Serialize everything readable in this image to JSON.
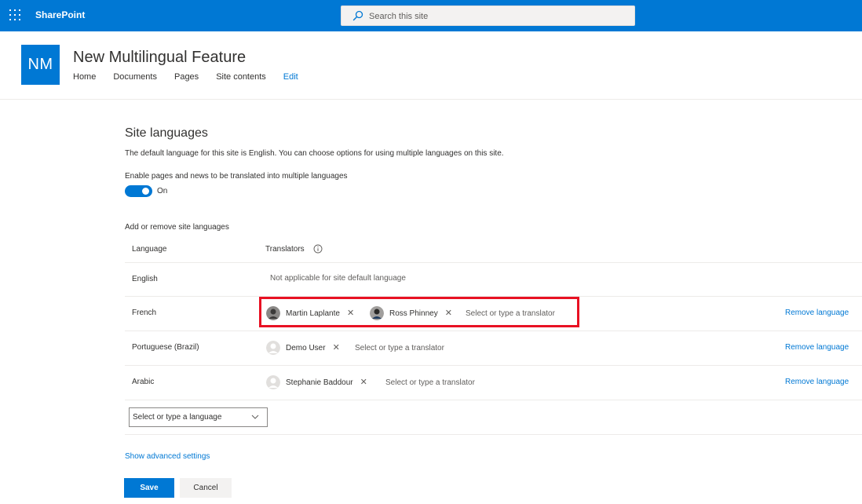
{
  "suite_bar": {
    "brand": "SharePoint",
    "search_placeholder": "Search this site"
  },
  "site": {
    "logo_initials": "NM",
    "title": "New Multilingual Feature",
    "nav": [
      "Home",
      "Documents",
      "Pages",
      "Site contents"
    ],
    "edit_label": "Edit"
  },
  "settings": {
    "heading": "Site languages",
    "description": "The default language for this site is English. You can choose options for using multiple languages on this site.",
    "toggle_label": "Enable pages and news to be translated into multiple languages",
    "toggle_state": "On",
    "toggle_on": true,
    "section_label": "Add or remove site languages",
    "table_headers": {
      "language": "Language",
      "translators": "Translators"
    },
    "rows": [
      {
        "language": "English",
        "note": "Not applicable for site default language"
      },
      {
        "language": "French",
        "translators": [
          "Martin Laplante",
          "Ross Phinney"
        ],
        "placeholder": "Select or type a translator",
        "remove_label": "Remove language"
      },
      {
        "language": "Portuguese (Brazil)",
        "translators": [
          "Demo User"
        ],
        "placeholder": "Select or type a translator",
        "remove_label": "Remove language"
      },
      {
        "language": "Arabic",
        "translators": [
          "Stephanie Baddour"
        ],
        "placeholder": "Select or type a translator",
        "remove_label": "Remove language"
      }
    ],
    "add_language_placeholder": "Select or type a language",
    "advanced_link": "Show advanced settings",
    "save_label": "Save",
    "cancel_label": "Cancel"
  },
  "colors": {
    "accent": "#0078d4",
    "highlight": "#e81123"
  }
}
